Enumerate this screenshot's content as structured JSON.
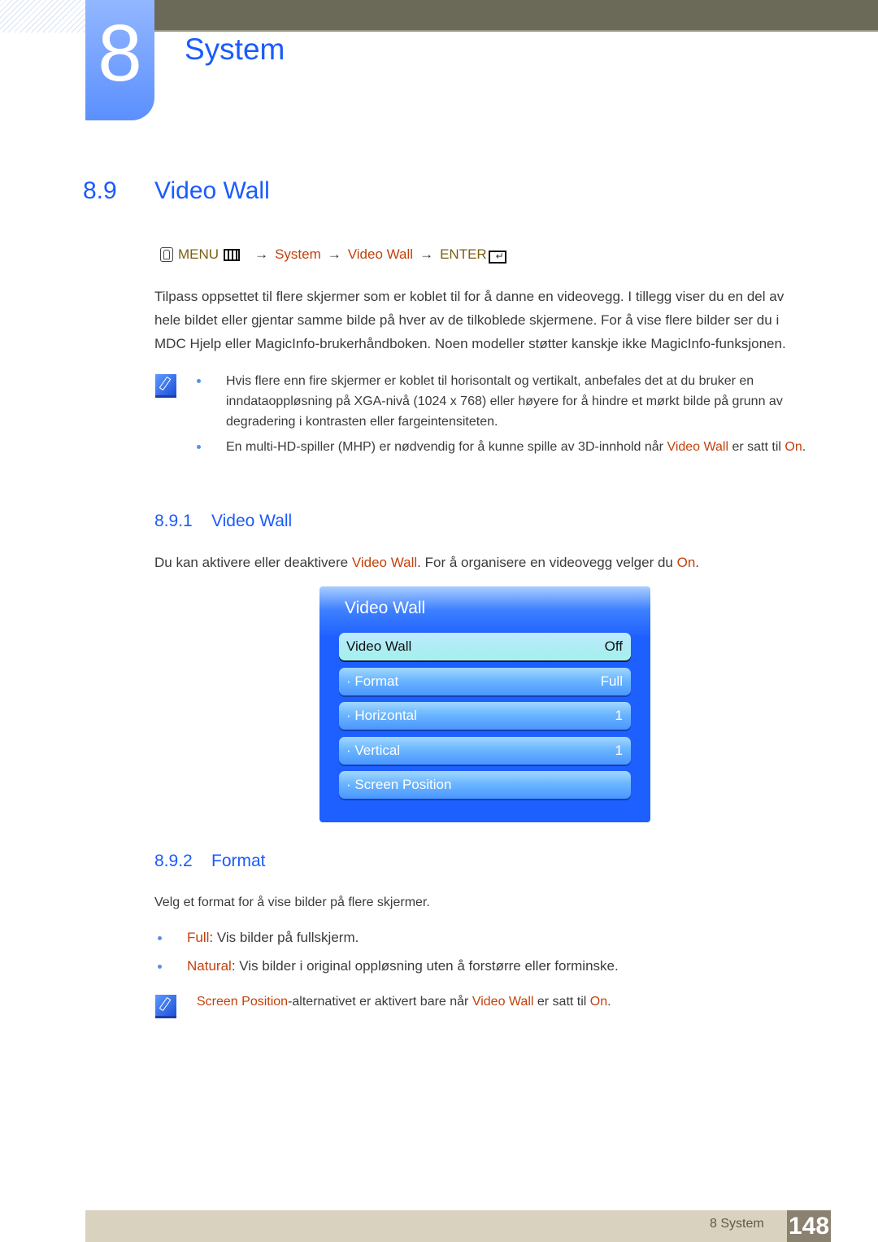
{
  "chapter": {
    "number": "8",
    "title": "System"
  },
  "section": {
    "number": "8.9",
    "title": "Video Wall"
  },
  "menu_path": {
    "menu_label": "MENU",
    "arrow": "→",
    "step1": "System",
    "step2": "Video Wall",
    "enter_label": "ENTER"
  },
  "intro": "Tilpass oppsettet til flere skjermer som er koblet til for å danne en videovegg. I tillegg viser du en del av hele bildet eller gjentar samme bilde på hver av de tilkoblede skjermene. For å vise flere bilder ser du i MDC Hjelp eller MagicInfo-brukerhåndboken. Noen modeller støtter kanskje ikke MagicInfo-funksjonen.",
  "notes": {
    "bullet1": "Hvis flere enn fire skjermer er koblet til horisontalt og vertikalt, anbefales det at du bruker en inndataoppløsning på XGA-nivå (1024 x 768) eller høyere for å hindre et mørkt bilde på grunn av degradering i kontrasten eller fargeintensiteten.",
    "bullet2_pre": "En multi-HD-spiller (MHP) er nødvendig for å kunne spille av 3D-innhold når ",
    "bullet2_hl1": "Video Wall",
    "bullet2_mid": " er satt til ",
    "bullet2_hl2": "On",
    "bullet2_post": "."
  },
  "sub1": {
    "number": "8.9.1",
    "title": "Video Wall",
    "text_pre": "Du kan aktivere eller deaktivere ",
    "text_hl1": "Video Wall",
    "text_mid": ". For å organisere en videovegg velger du ",
    "text_hl2": "On",
    "text_post": "."
  },
  "osd": {
    "title": "Video Wall",
    "items": [
      {
        "label": "Video Wall",
        "value": "Off"
      },
      {
        "label": "· Format",
        "value": "Full"
      },
      {
        "label": "· Horizontal",
        "value": "1"
      },
      {
        "label": "· Vertical",
        "value": "1"
      },
      {
        "label": "· Screen Position",
        "value": ""
      }
    ]
  },
  "sub2": {
    "number": "8.9.2",
    "title": "Format",
    "intro": "Velg et format for å vise bilder på flere skjermer.",
    "options": [
      {
        "name": "Full",
        "desc": ": Vis bilder på fullskjerm."
      },
      {
        "name": "Natural",
        "desc": ": Vis bilder i original oppløsning uten å forstørre eller forminske."
      }
    ],
    "note_hl1": "Screen Position",
    "note_mid": "-alternativet er aktivert bare når ",
    "note_hl2": "Video Wall",
    "note_mid2": " er satt til ",
    "note_hl3": "On",
    "note_post": "."
  },
  "footer": {
    "label": "8 System",
    "page": "148"
  }
}
